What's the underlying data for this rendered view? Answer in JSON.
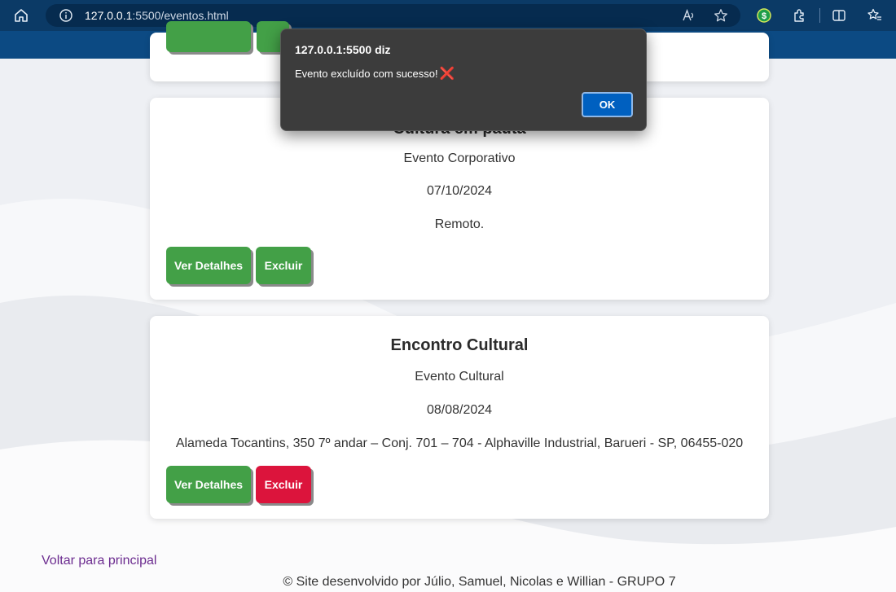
{
  "browser": {
    "url_host": "127.0.0.1",
    "url_rest": ":5500/eventos.html",
    "read_aloud_glyph": "Aᴬ"
  },
  "alert": {
    "title": "127.0.0.1:5500 diz",
    "message": "Evento excluído com sucesso!",
    "emoji": "❌",
    "ok_label": "OK"
  },
  "events": [
    {
      "title": "Cultura em pauta",
      "type": "Evento Corporativo",
      "date": "07/10/2024",
      "location": "Remoto.",
      "details_label": "Ver Detalhes",
      "delete_label": "Excluir"
    },
    {
      "title": "Encontro Cultural",
      "type": "Evento Cultural",
      "date": "08/08/2024",
      "location": "Alameda Tocantins, 350 7º andar – Conj. 701 – 704 - Alphaville Industrial, Barueri - SP, 06455-020",
      "details_label": "Ver Detalhes",
      "delete_label": "Excluir"
    }
  ],
  "footer": {
    "back_link": "Voltar para principal",
    "credits": "© Site desenvolvido por Júlio, Samuel, Nicolas e Willian - GRUPO 7"
  },
  "colors": {
    "header": "#0c4a83",
    "browser_bar": "#0b3a66",
    "button_green": "#43a047",
    "button_red": "#dc143c",
    "link": "#6b2b8f"
  }
}
